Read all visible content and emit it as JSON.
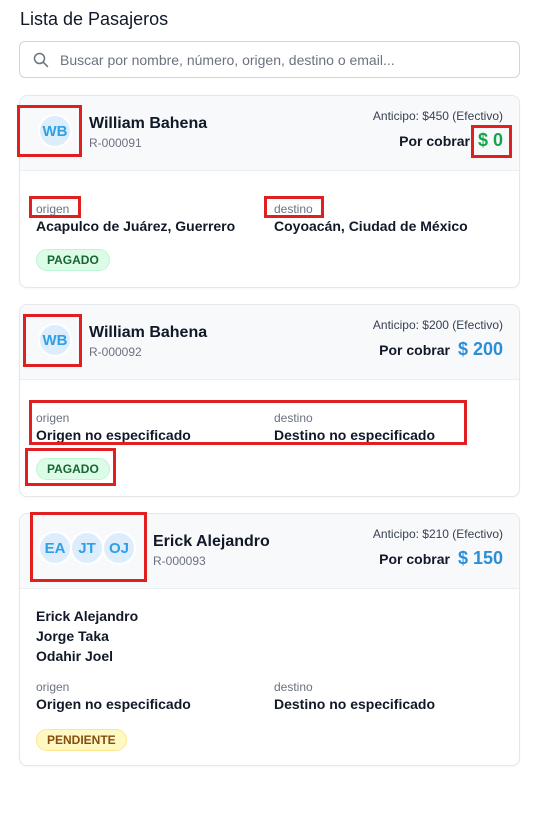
{
  "page": {
    "title": "Lista de Pasajeros"
  },
  "search": {
    "placeholder": "Buscar por nombre, número, origen, destino o email...",
    "value": ""
  },
  "labels": {
    "origin": "origen",
    "destination": "destino",
    "due": "Por cobrar"
  },
  "colors": {
    "avatar_text": "#2f9fe6",
    "avatar_bg": "#deedfb",
    "due_zero": "#16a34a",
    "due_positive": "#2a8fd8",
    "highlight": "#e02020"
  },
  "reservations": [
    {
      "initials": [
        "WB"
      ],
      "name": "William Bahena",
      "code": "R-000091",
      "advance": "Anticipo: $450 (Efectivo)",
      "due": "$ 0",
      "origin": "Acapulco de Juárez, Guerrero",
      "destination": "Coyoacán, Ciudad de México",
      "passengers": [],
      "status": "PAGADO"
    },
    {
      "initials": [
        "WB"
      ],
      "name": "William Bahena",
      "code": "R-000092",
      "advance": "Anticipo: $200 (Efectivo)",
      "due": "$ 200",
      "origin": "Origen no especificado",
      "destination": "Destino no especificado",
      "passengers": [],
      "status": "PAGADO"
    },
    {
      "initials": [
        "EA",
        "JT",
        "OJ"
      ],
      "name": "Erick Alejandro",
      "code": "R-000093",
      "advance": "Anticipo: $210 (Efectivo)",
      "due": "$ 150",
      "origin": "Origen no especificado",
      "destination": "Destino no especificado",
      "passengers": [
        "Erick Alejandro",
        "Jorge Taka",
        "Odahir Joel"
      ],
      "status": "PENDIENTE"
    }
  ]
}
